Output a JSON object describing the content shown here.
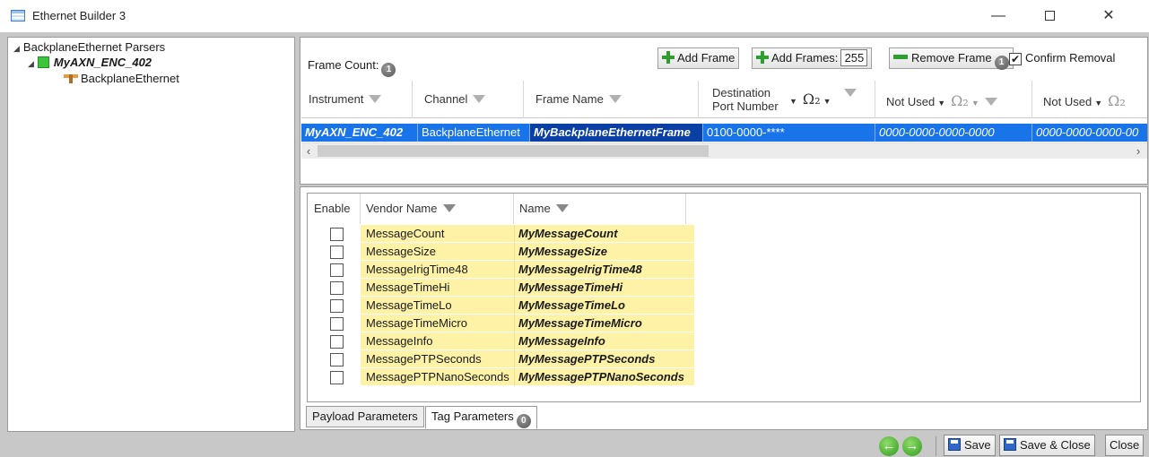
{
  "window": {
    "title": "Ethernet Builder 3",
    "minimize": "—",
    "close": "✕"
  },
  "tree": {
    "root": "BackplaneEthernet Parsers",
    "instrument": "MyAXN_ENC_402",
    "leaf": "BackplaneEthernet"
  },
  "frames": {
    "frame_count_label": "Frame Count:",
    "frame_count_badge": "1",
    "add_frame": "Add Frame",
    "add_frames": "Add Frames:",
    "add_frames_value": "255",
    "remove_frame": "Remove Frame",
    "remove_frame_badge": "1",
    "confirm_removal": "Confirm Removal",
    "confirm_checked": true,
    "columns": {
      "instrument": "Instrument",
      "channel": "Channel",
      "frame_name": "Frame Name",
      "dest_line1": "Destination",
      "dest_line2": "Port Number",
      "not_used_1": "Not Used",
      "not_used_2": "Not Used",
      "omega": "Ω₂"
    },
    "row": {
      "instrument": "MyAXN_ENC_402",
      "channel": "BackplaneEthernet",
      "frame_name": "MyBackplaneEthernetFrame",
      "destination": "0100-0000-****",
      "not_used_1": "0000-0000-0000-0000",
      "not_used_2": "0000-0000-0000-00"
    }
  },
  "params": {
    "columns": {
      "enable": "Enable",
      "vendor_name": "Vendor Name",
      "name": "Name"
    },
    "rows": [
      {
        "vendor": "MessageCount",
        "name": "MyMessageCount"
      },
      {
        "vendor": "MessageSize",
        "name": "MyMessageSize"
      },
      {
        "vendor": "MessageIrigTime48",
        "name": "MyMessageIrigTime48"
      },
      {
        "vendor": "MessageTimeHi",
        "name": "MyMessageTimeHi"
      },
      {
        "vendor": "MessageTimeLo",
        "name": "MyMessageTimeLo"
      },
      {
        "vendor": "MessageTimeMicro",
        "name": "MyMessageTimeMicro"
      },
      {
        "vendor": "MessageInfo",
        "name": "MyMessageInfo"
      },
      {
        "vendor": "MessagePTPSeconds",
        "name": "MyMessagePTPSeconds"
      },
      {
        "vendor": "MessagePTPNanoSeconds",
        "name": "MyMessagePTPNanoSeconds"
      }
    ],
    "tabs": {
      "payload": "Payload Parameters",
      "tag": "Tag Parameters",
      "tag_badge": "0"
    }
  },
  "footer": {
    "save": "Save",
    "save_close": "Save & Close",
    "close": "Close",
    "back": "←",
    "forward": "→"
  },
  "colors": {
    "selection": "#1874e8",
    "highlight_cell": "#fdf2a6",
    "background": "#c8c8c8"
  }
}
